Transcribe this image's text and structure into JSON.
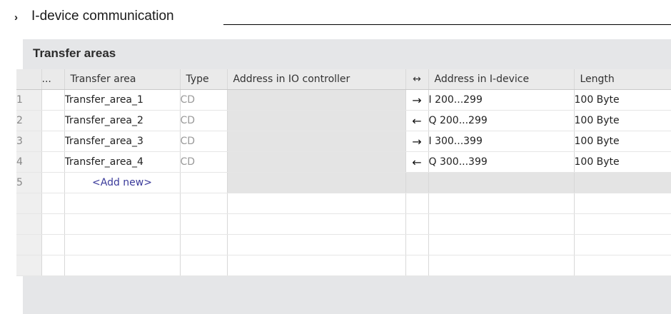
{
  "section": {
    "chevron": "›",
    "title": "I-device communication"
  },
  "panel": {
    "title": "Transfer areas"
  },
  "table": {
    "headers": {
      "dots": "...",
      "transfer_area": "Transfer area",
      "type": "Type",
      "addr_io": "Address in IO controller",
      "direction": "↔",
      "addr_idev": "Address in I-device",
      "length": "Length"
    },
    "rows": [
      {
        "num": "1",
        "name": "Transfer_area_1",
        "type": "CD",
        "addr_io": "",
        "arrow": "→",
        "addr_idev": "I 200...299",
        "length": "100 Byte"
      },
      {
        "num": "2",
        "name": "Transfer_area_2",
        "type": "CD",
        "addr_io": "",
        "arrow": "←",
        "addr_idev": "Q 200...299",
        "length": "100 Byte"
      },
      {
        "num": "3",
        "name": "Transfer_area_3",
        "type": "CD",
        "addr_io": "",
        "arrow": "→",
        "addr_idev": "I 300...399",
        "length": "100 Byte"
      },
      {
        "num": "4",
        "name": "Transfer_area_4",
        "type": "CD",
        "addr_io": "",
        "arrow": "←",
        "addr_idev": "Q 300...399",
        "length": "100 Byte"
      }
    ],
    "add_row": {
      "num": "5",
      "label": "<Add new>"
    }
  }
}
